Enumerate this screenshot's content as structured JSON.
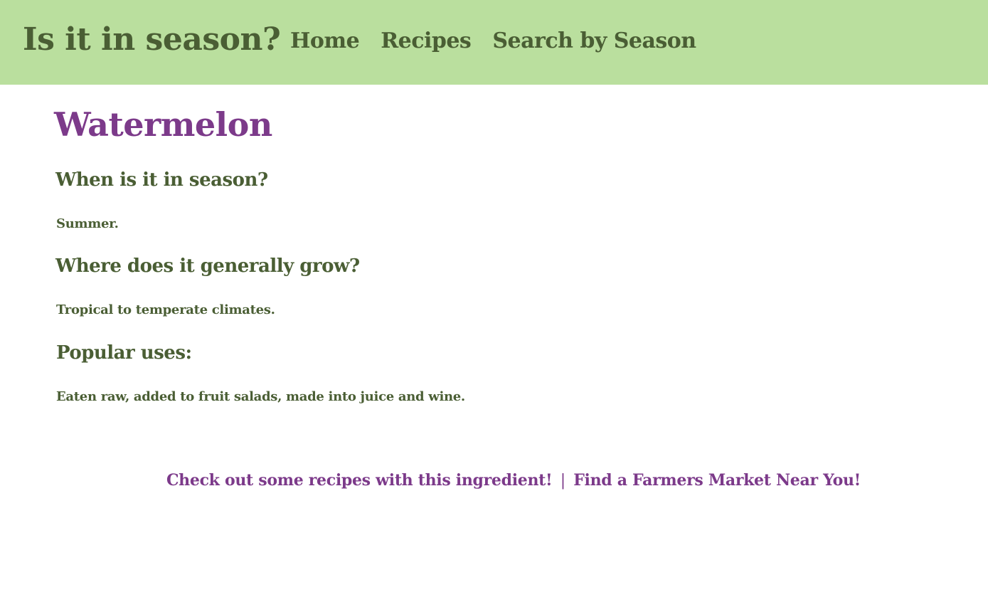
{
  "header": {
    "site_title": "Is it in season?",
    "nav": {
      "home": "Home",
      "recipes": "Recipes",
      "search_by_season": "Search by Season"
    }
  },
  "main": {
    "title": "Watermelon",
    "sections": [
      {
        "question": "When is it in season?",
        "answer": "Summer."
      },
      {
        "question": "Where does it generally grow?",
        "answer": "Tropical to temperate climates."
      },
      {
        "question": "Popular uses:",
        "answer": "Eaten raw, added to fruit salads, made into juice and wine."
      }
    ]
  },
  "footer": {
    "recipes_link": "Check out some recipes with this ingredient!",
    "separator": "|",
    "market_link": "Find a Farmers Market Near You!"
  },
  "colors": {
    "header_bg": "#badf9e",
    "text_green": "#4a5e34",
    "accent_purple": "#7c3a8a"
  }
}
